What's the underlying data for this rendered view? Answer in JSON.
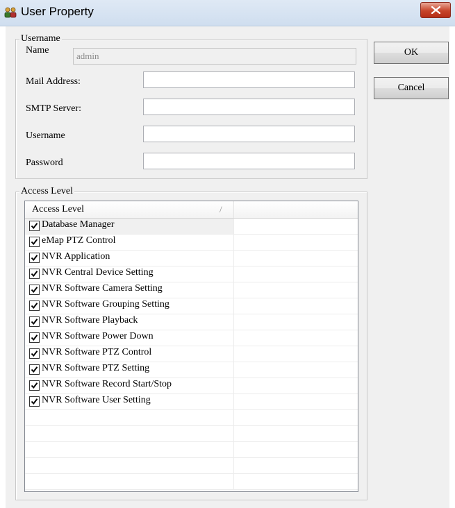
{
  "window": {
    "title": "User Property"
  },
  "username_group": {
    "legend": "Username",
    "name_label": "Name",
    "name_value": "admin",
    "mail_label": "Mail Address:",
    "mail_value": "",
    "smtp_label": "SMTP Server:",
    "smtp_value": "",
    "username_label": "Username",
    "username_value": "",
    "password_label": "Password",
    "password_value": ""
  },
  "buttons": {
    "ok": "OK",
    "cancel": "Cancel"
  },
  "access_group": {
    "legend": "Access Level",
    "column_header": "Access Level",
    "sort_glyph": "/",
    "items": [
      {
        "label": "Database Manager",
        "checked": true
      },
      {
        "label": "eMap PTZ Control",
        "checked": true
      },
      {
        "label": "NVR Application",
        "checked": true
      },
      {
        "label": "NVR Central Device Setting",
        "checked": true
      },
      {
        "label": "NVR Software Camera Setting",
        "checked": true
      },
      {
        "label": "NVR Software Grouping Setting",
        "checked": true
      },
      {
        "label": "NVR Software Playback",
        "checked": true
      },
      {
        "label": "NVR Software Power Down",
        "checked": true
      },
      {
        "label": "NVR Software PTZ Control",
        "checked": true
      },
      {
        "label": "NVR Software PTZ Setting",
        "checked": true
      },
      {
        "label": "NVR Software Record Start/Stop",
        "checked": true
      },
      {
        "label": "NVR Software User Setting",
        "checked": true
      }
    ]
  },
  "icons": {
    "app": "users-icon",
    "close": "close-icon",
    "check": "checkmark-icon"
  },
  "colors": {
    "close_button": "#c7442a",
    "titlebar": "#dfe9f5"
  }
}
